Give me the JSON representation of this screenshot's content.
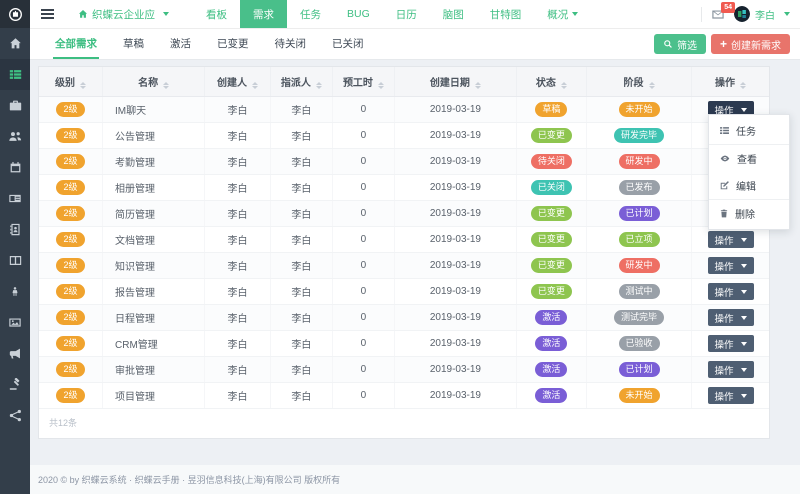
{
  "palette": {
    "brand": "#3dbe82",
    "navActiveBg": "#49bf8a",
    "filterBtn": "#4cc08c",
    "createBtn": "#e8746b",
    "badgeOrange": "#f0a32e",
    "badgeGreen": "#8ec54f",
    "badgeRed": "#ee6f64",
    "badgeTeal": "#3ec3b2",
    "badgeGray": "#99a0a8",
    "badgePurple": "#7a5ed6",
    "actionBtn": "#4e5e72",
    "actionBtnOpen": "#2c3a50",
    "notifBadge": "#f05a50"
  },
  "navbar": {
    "app_title": "织蝶云企业应",
    "items": [
      {
        "key": "kanban",
        "label": "看板"
      },
      {
        "key": "requirements",
        "label": "需求",
        "active": true
      },
      {
        "key": "tasks",
        "label": "任务"
      },
      {
        "key": "bug",
        "label": "BUG"
      },
      {
        "key": "calendar",
        "label": "日历"
      },
      {
        "key": "mindmap",
        "label": "脑图"
      },
      {
        "key": "gantt",
        "label": "甘特图"
      },
      {
        "key": "overview",
        "label": "概况",
        "caret": true
      }
    ],
    "notification_count": "54",
    "user_name": "李白"
  },
  "sidebar": {
    "items": [
      {
        "icon": "home"
      },
      {
        "icon": "th-list",
        "active": true
      },
      {
        "icon": "briefcase"
      },
      {
        "icon": "users"
      },
      {
        "icon": "calendar"
      },
      {
        "icon": "id-card"
      },
      {
        "icon": "address-book"
      },
      {
        "icon": "columns"
      },
      {
        "icon": "male"
      },
      {
        "icon": "image"
      },
      {
        "icon": "bullhorn"
      },
      {
        "icon": "gavel"
      },
      {
        "icon": "share-alt"
      }
    ]
  },
  "tabs": [
    {
      "key": "all",
      "label": "全部需求",
      "active": true
    },
    {
      "key": "draft",
      "label": "草稿"
    },
    {
      "key": "active",
      "label": "激活"
    },
    {
      "key": "changed",
      "label": "已变更"
    },
    {
      "key": "to-close",
      "label": "待关闭"
    },
    {
      "key": "closed",
      "label": "已关闭"
    }
  ],
  "toolbar": {
    "filter_label": "筛选",
    "create_label": "创建新需求"
  },
  "table": {
    "columns": [
      "级别",
      "名称",
      "创建人",
      "指派人",
      "预工时",
      "创建日期",
      "状态",
      "阶段",
      "操作"
    ],
    "action_label": "操作",
    "summary": "共12条",
    "rows": [
      {
        "level": "2级",
        "name": "IM聊天",
        "creator": "李白",
        "assignee": "李白",
        "hours": "0",
        "date": "2019-03-19",
        "status": {
          "text": "草稿",
          "color": "badgeOrange"
        },
        "stage": {
          "text": "未开始",
          "color": "badgeOrange"
        },
        "menu_open": true
      },
      {
        "level": "2级",
        "name": "公告管理",
        "creator": "李白",
        "assignee": "李白",
        "hours": "0",
        "date": "2019-03-19",
        "status": {
          "text": "已变更",
          "color": "badgeGreen"
        },
        "stage": {
          "text": "研发完毕",
          "color": "badgeTeal"
        }
      },
      {
        "level": "2级",
        "name": "考勤管理",
        "creator": "李白",
        "assignee": "李白",
        "hours": "0",
        "date": "2019-03-19",
        "status": {
          "text": "待关闭",
          "color": "badgeRed"
        },
        "stage": {
          "text": "研发中",
          "color": "badgeRed"
        }
      },
      {
        "level": "2级",
        "name": "相册管理",
        "creator": "李白",
        "assignee": "李白",
        "hours": "0",
        "date": "2019-03-19",
        "status": {
          "text": "已关闭",
          "color": "badgeTeal"
        },
        "stage": {
          "text": "已发布",
          "color": "badgeGray"
        }
      },
      {
        "level": "2级",
        "name": "简历管理",
        "creator": "李白",
        "assignee": "李白",
        "hours": "0",
        "date": "2019-03-19",
        "status": {
          "text": "已变更",
          "color": "badgeGreen"
        },
        "stage": {
          "text": "已计划",
          "color": "badgePurple"
        }
      },
      {
        "level": "2级",
        "name": "文档管理",
        "creator": "李白",
        "assignee": "李白",
        "hours": "0",
        "date": "2019-03-19",
        "status": {
          "text": "已变更",
          "color": "badgeGreen"
        },
        "stage": {
          "text": "已立项",
          "color": "badgeGreen"
        }
      },
      {
        "level": "2级",
        "name": "知识管理",
        "creator": "李白",
        "assignee": "李白",
        "hours": "0",
        "date": "2019-03-19",
        "status": {
          "text": "已变更",
          "color": "badgeGreen"
        },
        "stage": {
          "text": "研发中",
          "color": "badgeRed"
        }
      },
      {
        "level": "2级",
        "name": "报告管理",
        "creator": "李白",
        "assignee": "李白",
        "hours": "0",
        "date": "2019-03-19",
        "status": {
          "text": "已变更",
          "color": "badgeGreen"
        },
        "stage": {
          "text": "测试中",
          "color": "badgeGray"
        }
      },
      {
        "level": "2级",
        "name": "日程管理",
        "creator": "李白",
        "assignee": "李白",
        "hours": "0",
        "date": "2019-03-19",
        "status": {
          "text": "激活",
          "color": "badgePurple"
        },
        "stage": {
          "text": "测试完毕",
          "color": "badgeGray"
        }
      },
      {
        "level": "2级",
        "name": "CRM管理",
        "creator": "李白",
        "assignee": "李白",
        "hours": "0",
        "date": "2019-03-19",
        "status": {
          "text": "激活",
          "color": "badgePurple"
        },
        "stage": {
          "text": "已验收",
          "color": "badgeGray"
        }
      },
      {
        "level": "2级",
        "name": "审批管理",
        "creator": "李白",
        "assignee": "李白",
        "hours": "0",
        "date": "2019-03-19",
        "status": {
          "text": "激活",
          "color": "badgePurple"
        },
        "stage": {
          "text": "已计划",
          "color": "badgePurple"
        }
      },
      {
        "level": "2级",
        "name": "项目管理",
        "creator": "李白",
        "assignee": "李白",
        "hours": "0",
        "date": "2019-03-19",
        "status": {
          "text": "激活",
          "color": "badgePurple"
        },
        "stage": {
          "text": "未开始",
          "color": "badgeOrange"
        }
      }
    ]
  },
  "dropdown": {
    "groups": [
      [
        {
          "key": "task",
          "label": "任务",
          "icon": "tasks"
        }
      ],
      [
        {
          "key": "view",
          "label": "查看",
          "icon": "eye"
        },
        {
          "key": "edit",
          "label": "编辑",
          "icon": "edit"
        }
      ],
      [
        {
          "key": "delete",
          "label": "删除",
          "icon": "trash"
        }
      ]
    ]
  },
  "footer": {
    "text": "2020 © by 织蝶云系统 · 织蝶云手册 · 昱羽信息科技(上海)有限公司 版权所有"
  }
}
